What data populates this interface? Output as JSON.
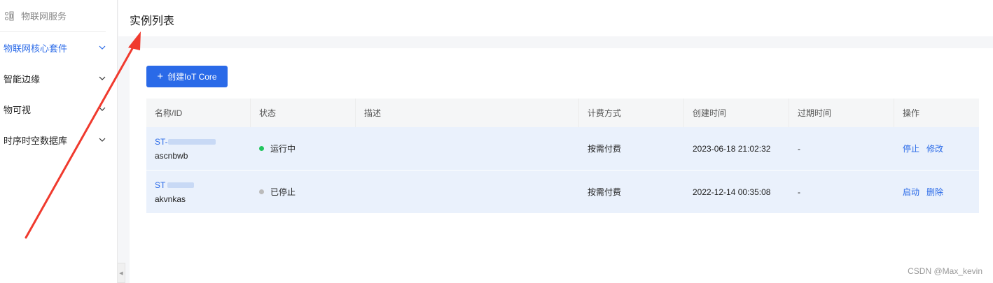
{
  "sidebar": {
    "title": "物联网服务",
    "items": [
      {
        "label": "物联网核心套件",
        "active": true
      },
      {
        "label": "智能边缘",
        "active": false
      },
      {
        "label": "物可视",
        "active": false
      },
      {
        "label": "时序时空数据库",
        "active": false
      }
    ]
  },
  "page": {
    "title": "实例列表"
  },
  "toolbar": {
    "create_label": "创建IoT Core"
  },
  "table": {
    "columns": [
      "名称/ID",
      "状态",
      "描述",
      "计费方式",
      "创建时间",
      "过期时间",
      "操作"
    ],
    "rows": [
      {
        "name_prefix": "ST-",
        "id": "ascnbwb",
        "status": "运行中",
        "status_color": "#22c55e",
        "description": "",
        "billing": "按需付费",
        "created": "2023-06-18 21:02:32",
        "expires": "-",
        "actions": [
          "停止",
          "修改"
        ]
      },
      {
        "name_prefix": "ST",
        "id": "akvnkas",
        "status": "已停止",
        "status_color": "#bbbbbb",
        "description": "",
        "billing": "按需付费",
        "created": "2022-12-14 00:35:08",
        "expires": "-",
        "actions": [
          "启动",
          "删除"
        ]
      }
    ]
  },
  "watermark": "CSDN @Max_kevin",
  "colors": {
    "accent": "#2a6ae8",
    "annotation_arrow": "#f03a2e"
  }
}
